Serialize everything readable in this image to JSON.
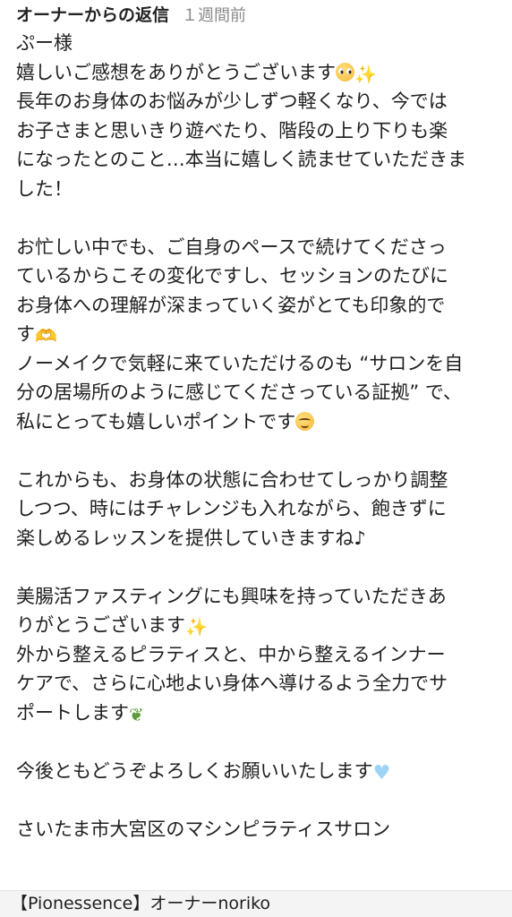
{
  "header": {
    "title": "オーナーからの返信",
    "time": "１週間前"
  },
  "body": {
    "greeting": "ぷー様",
    "p1": [
      "嬉しいご感想をありがとうございます",
      "長年のお身体のお悩みが少しずつ軽くなり、今では",
      "お子さまと思いきり遊べたり、階段の上り下りも楽",
      "になったとのこと…本当に嬉しく読ませていただきま",
      "した！"
    ],
    "p2": [
      "お忙しい中でも、ご自身のペースで続けてくださっ",
      "ているからこその変化ですし、セッションのたびに",
      "お身体への理解が深まっていく姿がとても印象的で",
      "す",
      "ノーメイクで気軽に来ていただけるのも “サロンを自",
      "分の居場所のように感じてくださっている証拠” で、",
      "私にとっても嬉しいポイントです"
    ],
    "p3": [
      "これからも、お身体の状態に合わせてしっかり調整",
      "しつつ、時にはチャレンジも入れながら、飽きずに",
      "楽しめるレッスンを提供していきますね♪"
    ],
    "p4": [
      "美腸活ファスティングにも興味を持っていただきあ",
      "りがとうございます",
      "外から整えるピラティスと、中から整えるインナー",
      "ケアで、さらに心地よい身体へ導けるよう全力でサ",
      "ポートします"
    ],
    "p5": [
      "今後ともどうぞよろしくお願いいたします"
    ],
    "p6": [
      "さいたま市大宮区のマシンピラティスサロン"
    ]
  },
  "signature": "【Pionessence】オーナーnoriko",
  "icons": {
    "sparkle": "✨",
    "hands": "🫶",
    "heart": "♥",
    "herb": "❦"
  },
  "colors": {
    "text": "#1f1f1f",
    "muted": "#8a8a8a",
    "background": "#ffffff",
    "signature_bar": "#f4f4f4"
  }
}
